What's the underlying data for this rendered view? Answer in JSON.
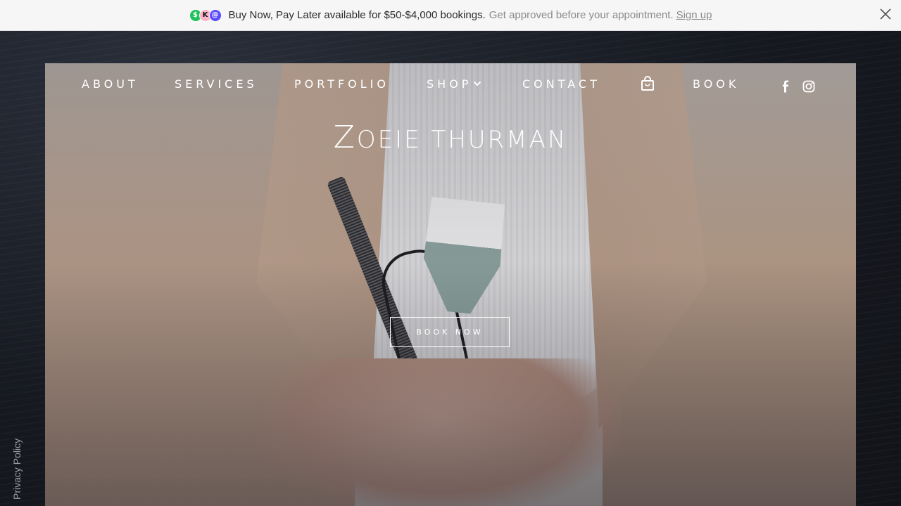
{
  "banner": {
    "main_text": "Buy Now, Pay Later available for $50-$4,000 bookings.",
    "sub_text": "Get approved before your appointment.",
    "link_label": "Sign up",
    "logos": [
      "cash-app-icon",
      "klarna-icon",
      "afterpay-icon"
    ]
  },
  "nav": {
    "about": "ABOUT",
    "services": "SERVICES",
    "portfolio": "PORTFOLIO",
    "shop": "SHOP",
    "contact": "CONTACT",
    "book": "BOOK"
  },
  "hero": {
    "title_first_letter": "Z",
    "title_rest": "oeie thurman",
    "button_label": "BOOK NOW"
  },
  "footer": {
    "privacy_label": "Privacy Policy"
  },
  "colors": {
    "banner_bg": "#f6f6f6",
    "page_bg": "#15171d",
    "nav_text": "#ffffff"
  }
}
